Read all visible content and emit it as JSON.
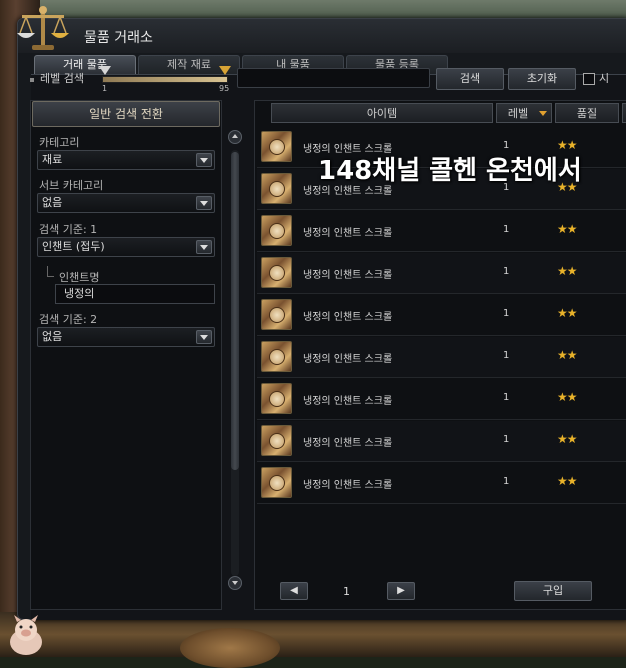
{
  "window": {
    "title": "물품 거래소"
  },
  "tabs": [
    {
      "label": "거래 물품",
      "active": true
    },
    {
      "label": "제작 재료",
      "active": false
    },
    {
      "label": "내 물품",
      "active": false
    },
    {
      "label": "물품 등록",
      "active": false
    }
  ],
  "level_search": {
    "label": "레벨 검색",
    "min": "1",
    "max": "95",
    "search_value": ""
  },
  "buttons": {
    "search": "검색",
    "reset": "초기화",
    "buy": "구입"
  },
  "checkbox_label": "시",
  "left": {
    "switch_label": "일반 검색 전환",
    "category_label": "카테고리",
    "category_value": "재료",
    "sub_category_label": "서브 카테고리",
    "sub_category_value": "없음",
    "criteria1_label": "검색 기준: 1",
    "criteria1_value": "인챈트 (접두)",
    "enchant_name_label": "인챈트명",
    "enchant_name_value": "냉정의",
    "criteria2_label": "검색 기준: 2",
    "criteria2_value": "없음"
  },
  "table": {
    "headers": {
      "item": "아이템",
      "level": "레벨",
      "grade": "품질"
    },
    "rows": [
      {
        "name": "냉정의 인챈트 스크롤",
        "level": "1",
        "grade": "★★"
      },
      {
        "name": "냉정의 인챈트 스크롤",
        "level": "1",
        "grade": "★★"
      },
      {
        "name": "냉정의 인챈트 스크롤",
        "level": "1",
        "grade": "★★"
      },
      {
        "name": "냉정의 인챈트 스크롤",
        "level": "1",
        "grade": "★★"
      },
      {
        "name": "냉정의 인챈트 스크롤",
        "level": "1",
        "grade": "★★"
      },
      {
        "name": "냉정의 인챈트 스크롤",
        "level": "1",
        "grade": "★★"
      },
      {
        "name": "냉정의 인챈트 스크롤",
        "level": "1",
        "grade": "★★"
      },
      {
        "name": "냉정의 인챈트 스크롤",
        "level": "1",
        "grade": "★★"
      },
      {
        "name": "냉정의 인챈트 스크롤",
        "level": "1",
        "grade": "★★"
      }
    ]
  },
  "overlay_caption": "148채널 콜헨 온천에서",
  "pagination": {
    "current_page": "1",
    "prev_icon": "chevron-left-icon",
    "next_icon": "chevron-right-icon"
  },
  "colors": {
    "grade_star": "#e8b22a",
    "window_bg": "#16191d"
  }
}
